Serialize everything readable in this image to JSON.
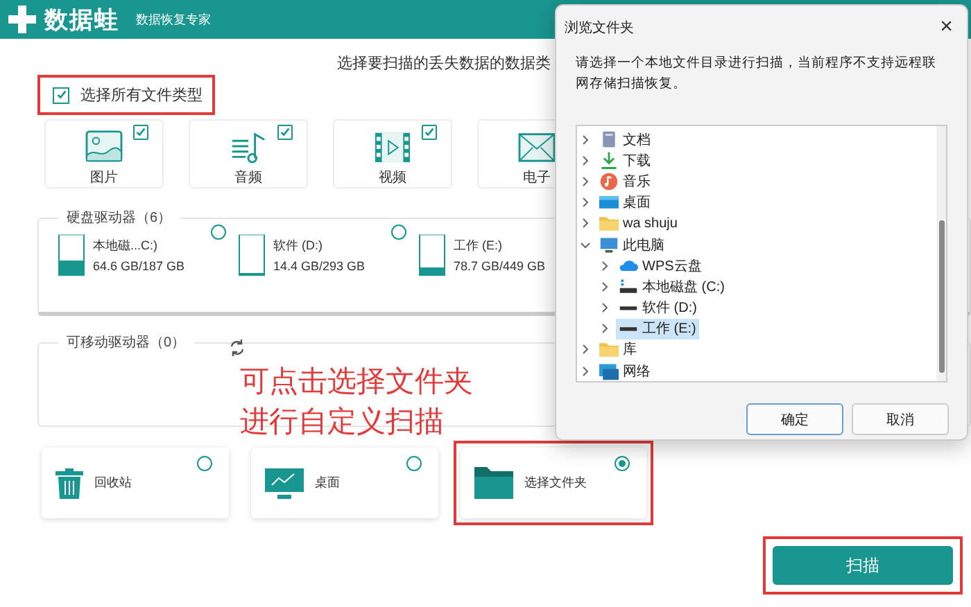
{
  "app": {
    "name": "数据蛙",
    "subtitle": "数据恢复专家"
  },
  "heading": "选择要扫描的丢失数据的数据类",
  "select_all": {
    "label": "选择所有文件类型",
    "checked": true,
    "highlighted": true
  },
  "file_types": [
    {
      "kind": "image",
      "label": "图片",
      "checked": true
    },
    {
      "kind": "audio",
      "label": "音频",
      "checked": true
    },
    {
      "kind": "video",
      "label": "视频",
      "checked": true
    },
    {
      "kind": "document",
      "label": "电子"
    }
  ],
  "hard_drives": {
    "title": "硬盘驱动器（6）",
    "drives": [
      {
        "name": "本地磁...C:)",
        "usage": "64.6 GB/187 GB",
        "level": 0.35,
        "selected": false
      },
      {
        "name": "软件 (D:)",
        "usage": "14.4 GB/293 GB",
        "level": 0.05,
        "selected": false
      },
      {
        "name": "工作 (E:)",
        "usage": "78.7 GB/449 GB",
        "level": 0.18
      }
    ]
  },
  "removable_drives": {
    "title": "可移动驱动器（0）"
  },
  "annotation": {
    "lines": [
      "可点击选择文件夹",
      "进行自定义扫描"
    ]
  },
  "locations": [
    {
      "kind": "recycle",
      "label": "回收站",
      "selected": false,
      "highlighted": false
    },
    {
      "kind": "desktop",
      "label": "桌面",
      "selected": false,
      "highlighted": false
    },
    {
      "kind": "folder",
      "label": "选择文件夹",
      "selected": true,
      "highlighted": true
    }
  ],
  "scan_button": {
    "label": "扫描",
    "highlighted": true
  },
  "dialog": {
    "title": "浏览文件夹",
    "close": "×",
    "description": "请选择一个本地文件目录进行扫描，当前程序不支持远程联网存储扫描恢复。",
    "tree": [
      {
        "kind": "document",
        "label": "文档",
        "expanded": false,
        "selected": false
      },
      {
        "kind": "download",
        "label": "下载",
        "expanded": false,
        "selected": false
      },
      {
        "kind": "music",
        "label": "音乐",
        "expanded": false,
        "selected": false
      },
      {
        "kind": "desktop",
        "label": "桌面",
        "expanded": false,
        "selected": false
      },
      {
        "kind": "folder",
        "label": "wa shuju",
        "expanded": false,
        "selected": false
      },
      {
        "kind": "computer",
        "label": "此电脑",
        "expanded": true,
        "selected": false,
        "children": [
          {
            "kind": "cloud",
            "label": "WPS云盘",
            "expanded": false,
            "selected": false
          },
          {
            "kind": "system-drive",
            "label": "本地磁盘 (C:)",
            "expanded": false,
            "selected": false
          },
          {
            "kind": "drive",
            "label": "软件 (D:)",
            "expanded": false,
            "selected": false
          },
          {
            "kind": "drive",
            "label": "工作 (E:)",
            "expanded": false,
            "selected": true
          }
        ]
      },
      {
        "kind": "folder",
        "label": "库",
        "expanded": false,
        "selected": false
      },
      {
        "kind": "network",
        "label": "网络",
        "expanded": false,
        "selected": false
      }
    ],
    "buttons": [
      {
        "kind": "primary",
        "label": "确定"
      },
      {
        "kind": "secondary",
        "label": "取消"
      }
    ]
  }
}
